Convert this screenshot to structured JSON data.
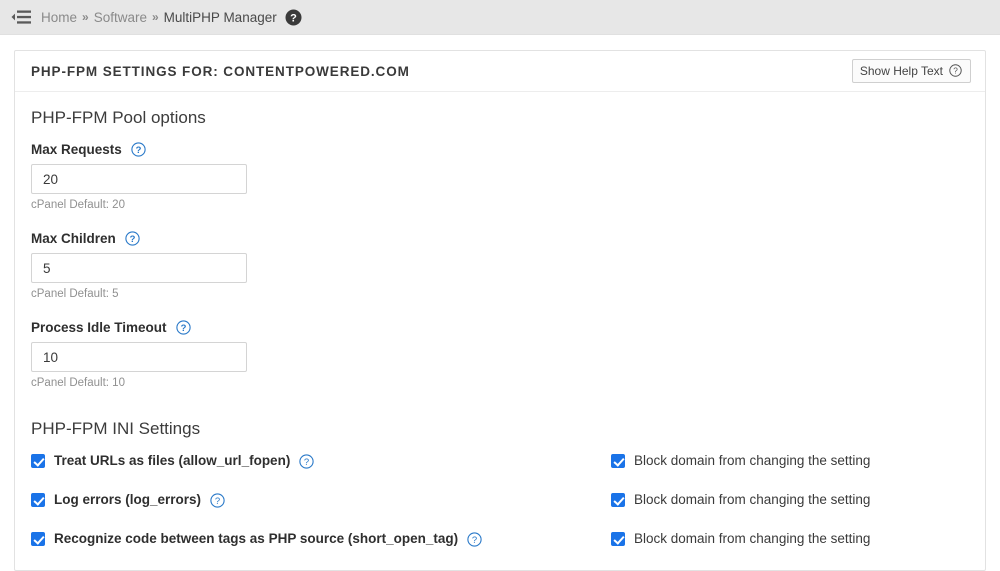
{
  "topbar": {
    "menu_icon": "hamburger-collapse-icon",
    "breadcrumb": {
      "items": [
        {
          "label": "Home",
          "current": false
        },
        {
          "label": "Software",
          "current": false
        },
        {
          "label": "MultiPHP Manager",
          "current": true
        }
      ],
      "separator": "»"
    },
    "help_icon": "help-circle-filled-icon"
  },
  "panel": {
    "title": "PHP-FPM SETTINGS FOR: CONTENTPOWERED.COM",
    "help_button": {
      "label": "Show Help Text",
      "icon": "help-circle-outline-icon"
    }
  },
  "pool_options": {
    "section_title": "PHP-FPM Pool options",
    "fields": [
      {
        "label": "Max Requests",
        "value": "20",
        "placeholder": "",
        "note": "cPanel Default: 20",
        "help_icon": "help-circle-outline-icon"
      },
      {
        "label": "Max Children",
        "value": "5",
        "placeholder": "",
        "note": "cPanel Default: 5",
        "help_icon": "help-circle-outline-icon"
      },
      {
        "label": "Process Idle Timeout",
        "value": "10",
        "placeholder": "",
        "note": "cPanel Default: 10",
        "help_icon": "help-circle-outline-icon"
      }
    ]
  },
  "ini_settings": {
    "section_title": "PHP-FPM INI Settings",
    "rows": [
      {
        "setting_label": "Treat URLs as files (allow_url_fopen)",
        "setting_checked": true,
        "setting_help_icon": "help-circle-outline-icon",
        "block_label": "Block domain from changing the setting",
        "block_checked": true
      },
      {
        "setting_label": "Log errors (log_errors)",
        "setting_checked": true,
        "setting_help_icon": "help-circle-outline-icon",
        "block_label": "Block domain from changing the setting",
        "block_checked": true
      },
      {
        "setting_label": "Recognize code between tags as PHP source (short_open_tag)",
        "setting_checked": true,
        "setting_help_icon": "help-circle-outline-icon",
        "block_label": "Block domain from changing the setting",
        "block_checked": true
      }
    ]
  },
  "colors": {
    "accent_blue": "#1a73e8",
    "topbar_bg": "#e7e7e7",
    "panel_border": "#e2e2e2",
    "muted_text": "#909090"
  }
}
